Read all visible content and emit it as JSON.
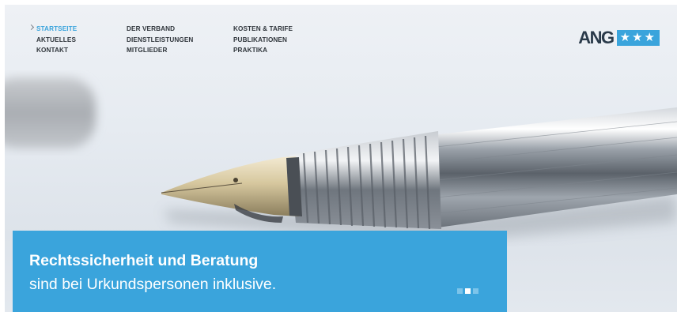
{
  "nav": {
    "col1": [
      "STARTSEITE",
      "AKTUELLES",
      "KONTAKT"
    ],
    "col2": [
      "DER VERBAND",
      "DIENSTLEISTUNGEN",
      "MITGLIEDER"
    ],
    "col3": [
      "KOSTEN & TARIFE",
      "PUBLIKATIONEN",
      "PRAKTIKA"
    ],
    "active": "STARTSEITE"
  },
  "logo": {
    "text": "ANG",
    "stars": "★★★"
  },
  "hero": {
    "image": "fountain-pen-photo",
    "caption_title": "Rechtssicherheit und Beratung",
    "caption_subtitle": "sind bei Urkundspersonen inklusive.",
    "slide_count": 3,
    "active_slide": 2
  },
  "colors": {
    "accent": "#3aa4dc",
    "nav_text": "#30363c",
    "logo_dark": "#2a3a4a"
  }
}
